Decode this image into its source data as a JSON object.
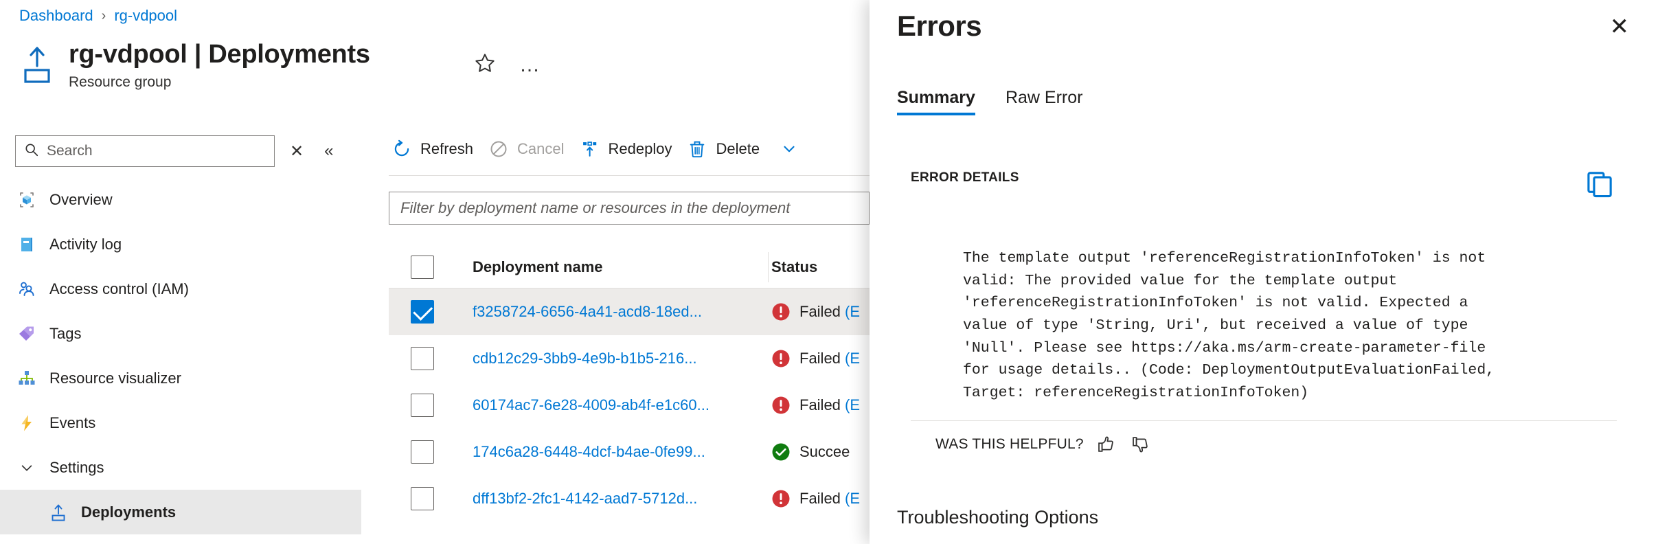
{
  "breadcrumb": {
    "items": [
      "Dashboard",
      "rg-vdpool"
    ],
    "separator": "›"
  },
  "header": {
    "title": "rg-vdpool | Deployments",
    "subtitle": "Resource group",
    "icon": "resource-group-icon",
    "favorite_icon": "star-icon",
    "more_label": "…"
  },
  "search": {
    "placeholder": "Search",
    "value": "",
    "icon": "search-icon",
    "close_icon": "✕",
    "collapse_icon": "«"
  },
  "sidebar": {
    "items": [
      {
        "label": "Overview",
        "icon": "overview-icon",
        "selected": false,
        "sub": false
      },
      {
        "label": "Activity log",
        "icon": "activity-log-icon",
        "selected": false,
        "sub": false
      },
      {
        "label": "Access control (IAM)",
        "icon": "access-control-icon",
        "selected": false,
        "sub": false
      },
      {
        "label": "Tags",
        "icon": "tags-icon",
        "selected": false,
        "sub": false
      },
      {
        "label": "Resource visualizer",
        "icon": "resource-visualizer-icon",
        "selected": false,
        "sub": false
      },
      {
        "label": "Events",
        "icon": "events-icon",
        "selected": false,
        "sub": false
      },
      {
        "label": "Settings",
        "icon": "chevron-down-icon",
        "selected": false,
        "sub": false,
        "group": true
      },
      {
        "label": "Deployments",
        "icon": "deployments-icon",
        "selected": true,
        "sub": true
      }
    ]
  },
  "toolbar": {
    "buttons": [
      {
        "label": "Refresh",
        "icon": "refresh-icon",
        "disabled": false
      },
      {
        "label": "Cancel",
        "icon": "cancel-icon",
        "disabled": true
      },
      {
        "label": "Redeploy",
        "icon": "redeploy-icon",
        "disabled": false
      },
      {
        "label": "Delete",
        "icon": "delete-icon",
        "disabled": false
      }
    ]
  },
  "filter": {
    "placeholder": "Filter by deployment name or resources in the deployment"
  },
  "table": {
    "columns": [
      "Deployment name",
      "Status"
    ],
    "header_checkbox_checked": false,
    "rows": [
      {
        "checked": true,
        "name": "f3258724-6656-4a41-acd8-18ed...",
        "status": "Failed",
        "status_detail": "(E",
        "severity": "error",
        "selected": true
      },
      {
        "checked": false,
        "name": "cdb12c29-3bb9-4e9b-b1b5-216...",
        "status": "Failed",
        "status_detail": "(E",
        "severity": "error",
        "selected": false
      },
      {
        "checked": false,
        "name": "60174ac7-6e28-4009-ab4f-e1c60...",
        "status": "Failed",
        "status_detail": "(E",
        "severity": "error",
        "selected": false
      },
      {
        "checked": false,
        "name": "174c6a28-6448-4dcf-b4ae-0fe99...",
        "status": "Succee",
        "status_detail": "",
        "severity": "success",
        "selected": false
      },
      {
        "checked": false,
        "name": "dff13bf2-2fc1-4142-aad7-5712d...",
        "status": "Failed",
        "status_detail": "(E",
        "severity": "error",
        "selected": false
      }
    ]
  },
  "flyout": {
    "title": "Errors",
    "close_icon": "✕",
    "tabs": [
      {
        "label": "Summary",
        "active": true
      },
      {
        "label": "Raw Error",
        "active": false
      }
    ],
    "error_details_label": "ERROR DETAILS",
    "copy_icon": "copy-icon",
    "error_text": "The template output 'referenceRegistrationInfoToken' is not\nvalid: The provided value for the template output\n'referenceRegistrationInfoToken' is not valid. Expected a\nvalue of type 'String, Uri', but received a value of type\n'Null'. Please see https://aka.ms/arm-create-parameter-file\nfor usage details.. (Code: DeploymentOutputEvaluationFailed,\nTarget: referenceRegistrationInfoToken)",
    "helpful_label": "WAS THIS HELPFUL?",
    "thumbs_up_icon": "thumbs-up-icon",
    "thumbs_down_icon": "thumbs-down-icon",
    "troubleshooting_title": "Troubleshooting Options"
  },
  "colors": {
    "accent": "#0078d4",
    "error": "#d13438",
    "success": "#107c10",
    "selected_row": "#edebe9"
  }
}
